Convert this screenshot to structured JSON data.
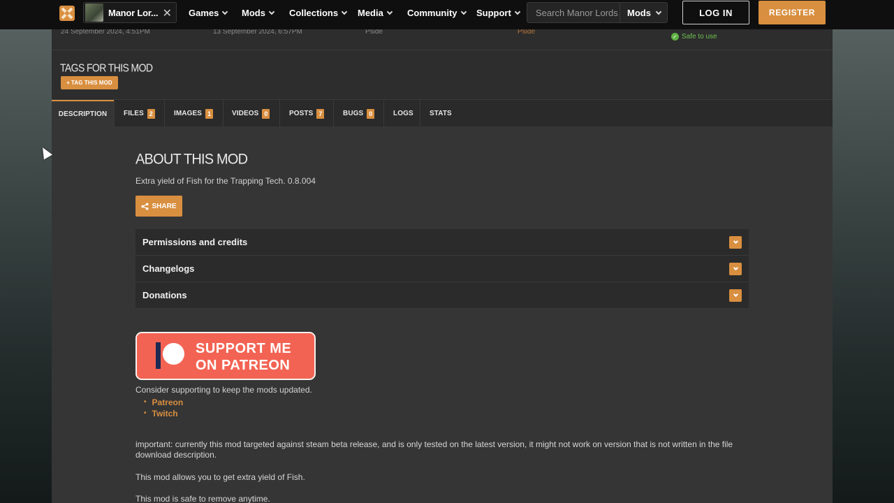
{
  "nav": {
    "game_name": "Manor Lor...",
    "close_glyph": "✕",
    "items": [
      {
        "label": "Games"
      },
      {
        "label": "Mods"
      },
      {
        "label": "Collections"
      },
      {
        "label": "Media"
      },
      {
        "label": "Community"
      },
      {
        "label": "Support"
      }
    ],
    "search_placeholder": "Search Manor Lords",
    "search_scope": "Mods",
    "login_label": "LOG IN",
    "register_label": "REGISTER"
  },
  "meta": {
    "date_uploaded": "24 September 2024, 4:51PM",
    "date_created": "13 September 2024, 6:57PM",
    "author": "Pside",
    "uploader": "Pside",
    "virus_scan": "Safe to use"
  },
  "tags": {
    "title": "TAGS FOR THIS MOD",
    "button_label": "TAG THIS MOD"
  },
  "tabs": [
    {
      "label": "DESCRIPTION",
      "count": null
    },
    {
      "label": "FILES",
      "count": "2"
    },
    {
      "label": "IMAGES",
      "count": "1"
    },
    {
      "label": "VIDEOS",
      "count": "0"
    },
    {
      "label": "POSTS",
      "count": "7"
    },
    {
      "label": "BUGS",
      "count": "0"
    },
    {
      "label": "LOGS",
      "count": null
    },
    {
      "label": "STATS",
      "count": null
    }
  ],
  "about": {
    "title": "ABOUT THIS MOD",
    "summary": "Extra yield of Fish for the Trapping Tech. 0.8.004",
    "share_label": "SHARE"
  },
  "accordion": [
    {
      "label": "Permissions and credits"
    },
    {
      "label": "Changelogs"
    },
    {
      "label": "Donations"
    }
  ],
  "patreon": {
    "line1": "SUPPORT ME",
    "line2": "ON PATREON"
  },
  "description": {
    "consider": "Consider supporting to keep the mods updated.",
    "links": [
      "Patreon",
      "Twitch"
    ],
    "important": "important: currently this mod targeted against steam beta release, and is only tested on the latest version, it might not work on version that is not written in the file download description.",
    "allows": "This mod allows you to get extra yield of Fish.",
    "safe_remove": "This mod is safe to remove anytime."
  },
  "colors": {
    "accent": "#d98f40",
    "safe": "#6fc04f",
    "patreon": "#f36353"
  }
}
